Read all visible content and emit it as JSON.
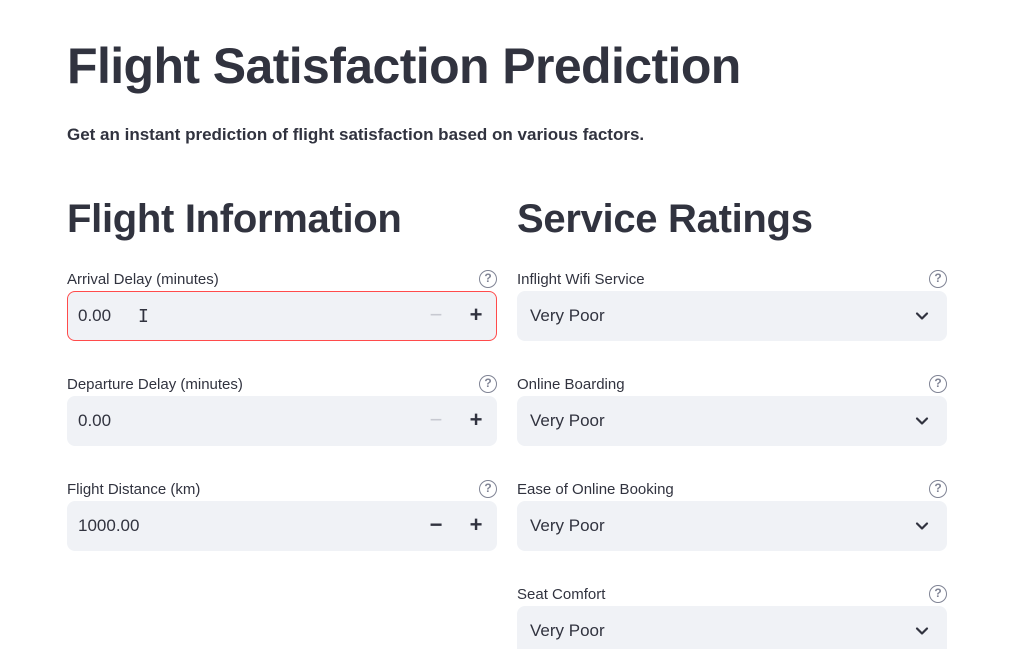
{
  "header": {
    "title": "Flight Satisfaction Prediction",
    "subtitle": "Get an instant prediction of flight satisfaction based on various factors."
  },
  "flight_info": {
    "heading": "Flight Information",
    "fields": [
      {
        "label": "Arrival Delay (minutes)",
        "value": "0.00",
        "minus_disabled": true,
        "focused": true,
        "help_icon": "question-circle-icon"
      },
      {
        "label": "Departure Delay (minutes)",
        "value": "0.00",
        "minus_disabled": true,
        "focused": false,
        "help_icon": "question-circle-icon"
      },
      {
        "label": "Flight Distance (km)",
        "value": "1000.00",
        "minus_disabled": false,
        "focused": false,
        "help_icon": "question-circle-icon"
      }
    ],
    "minus_symbol": "−",
    "plus_symbol": "+"
  },
  "service_ratings": {
    "heading": "Service Ratings",
    "fields": [
      {
        "label": "Inflight Wifi Service",
        "value": "Very Poor",
        "help_icon": "question-circle-icon"
      },
      {
        "label": "Online Boarding",
        "value": "Very Poor",
        "help_icon": "question-circle-icon"
      },
      {
        "label": "Ease of Online Booking",
        "value": "Very Poor",
        "help_icon": "question-circle-icon"
      },
      {
        "label": "Seat Comfort",
        "value": "Very Poor",
        "help_icon": "question-circle-icon"
      }
    ]
  },
  "help_glyph": "?",
  "colors": {
    "text": "#31333f",
    "input_bg": "#f0f2f6",
    "focus_border": "#ff4b4b",
    "muted_icon": "#808495"
  }
}
